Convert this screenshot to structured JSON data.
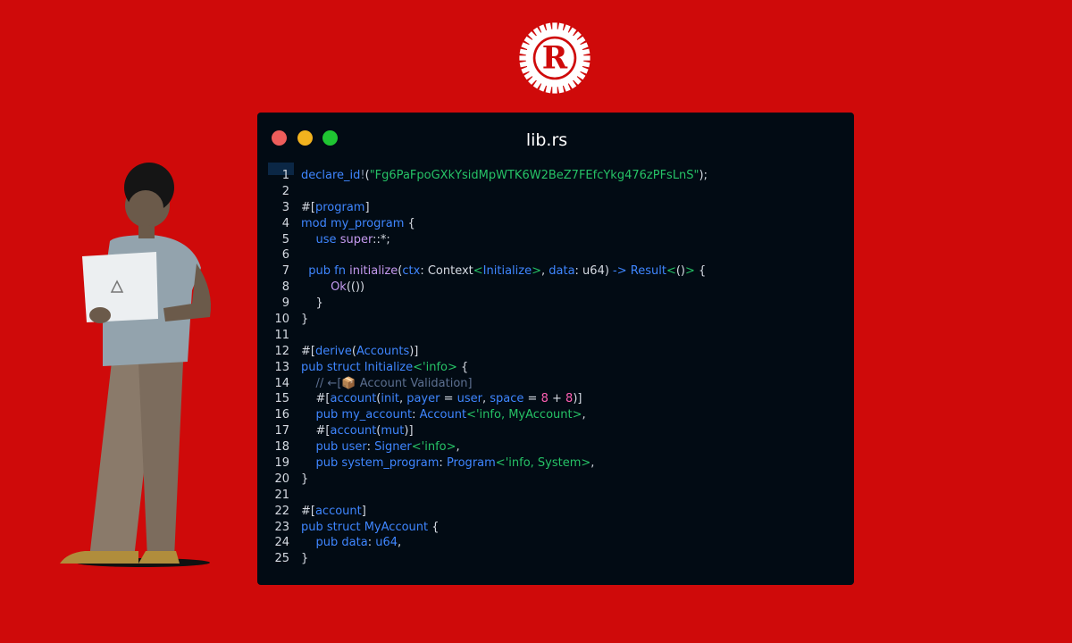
{
  "window": {
    "title": "lib.rs"
  },
  "colors": {
    "background": "#cf0a0a",
    "editor_bg": "#020b14",
    "keyword": "#3f86ff",
    "string": "#26c266",
    "number": "#ff5fb3",
    "comment": "#5c6f90"
  },
  "icons": [
    "rust-logo",
    "window-close-dot",
    "window-minimize-dot",
    "window-maximize-dot",
    "package-emoji-icon"
  ],
  "code": {
    "language": "rust",
    "lines": [
      {
        "n": "1",
        "tokens": [
          [
            "b",
            "declare_id"
          ],
          [
            "d",
            "!"
          ],
          [
            "w",
            "("
          ],
          [
            "g",
            "\"Fg6PaFpoGXkYsidMpWTK6W2BeZ7FEfcYkg476zPFsLnS\""
          ],
          [
            "w",
            ");"
          ]
        ]
      },
      {
        "n": "2",
        "tokens": []
      },
      {
        "n": "3",
        "tokens": [
          [
            "w",
            "#["
          ],
          [
            "b",
            "program"
          ],
          [
            "w",
            "]"
          ]
        ]
      },
      {
        "n": "4",
        "tokens": [
          [
            "b",
            "mod "
          ],
          [
            "b",
            "my_program"
          ],
          [
            "w",
            " {"
          ]
        ]
      },
      {
        "n": "5",
        "tokens": [
          [
            "w",
            "    "
          ],
          [
            "b",
            "use "
          ],
          [
            "v",
            "super"
          ],
          [
            "w",
            "::*;"
          ]
        ]
      },
      {
        "n": "6",
        "tokens": []
      },
      {
        "n": "7",
        "tokens": [
          [
            "w",
            "  "
          ],
          [
            "b",
            "pub fn "
          ],
          [
            "v",
            "initialize"
          ],
          [
            "w",
            "("
          ],
          [
            "b",
            "ctx"
          ],
          [
            "w",
            ": Context"
          ],
          [
            "g",
            "<"
          ],
          [
            "b",
            "Initialize"
          ],
          [
            "g",
            ">"
          ],
          [
            "w",
            ", "
          ],
          [
            "b",
            "data"
          ],
          [
            "w",
            ": u64) "
          ],
          [
            "b",
            "-> Result"
          ],
          [
            "g",
            "<"
          ],
          [
            "w",
            "()"
          ],
          [
            "g",
            ">"
          ],
          [
            "w",
            " {"
          ]
        ]
      },
      {
        "n": "8",
        "tokens": [
          [
            "w",
            "        "
          ],
          [
            "v",
            "Ok"
          ],
          [
            "w",
            "(())"
          ]
        ]
      },
      {
        "n": "9",
        "tokens": [
          [
            "w",
            "    }"
          ]
        ]
      },
      {
        "n": "10",
        "tokens": [
          [
            "w",
            "}"
          ]
        ]
      },
      {
        "n": "11",
        "tokens": []
      },
      {
        "n": "12",
        "tokens": [
          [
            "w",
            "#["
          ],
          [
            "b",
            "derive"
          ],
          [
            "w",
            "("
          ],
          [
            "b",
            "Accounts"
          ],
          [
            "w",
            ")]"
          ]
        ]
      },
      {
        "n": "13",
        "tokens": [
          [
            "b",
            "pub struct "
          ],
          [
            "b",
            "Initialize"
          ],
          [
            "g",
            "<'info>"
          ],
          [
            "w",
            " {"
          ]
        ]
      },
      {
        "n": "14",
        "tokens": [
          [
            "w",
            "    "
          ],
          [
            "c",
            "// ←[📦 Account Validation]"
          ]
        ]
      },
      {
        "n": "15",
        "tokens": [
          [
            "w",
            "    #["
          ],
          [
            "b",
            "account"
          ],
          [
            "w",
            "("
          ],
          [
            "b",
            "init"
          ],
          [
            "w",
            ", "
          ],
          [
            "b",
            "payer"
          ],
          [
            "w",
            " = "
          ],
          [
            "b",
            "user"
          ],
          [
            "w",
            ", "
          ],
          [
            "b",
            "space"
          ],
          [
            "w",
            " = "
          ],
          [
            "p",
            "8"
          ],
          [
            "w",
            " + "
          ],
          [
            "p",
            "8"
          ],
          [
            "w",
            ")]"
          ]
        ]
      },
      {
        "n": "16",
        "tokens": [
          [
            "w",
            "    "
          ],
          [
            "b",
            "pub "
          ],
          [
            "b",
            "my_account"
          ],
          [
            "w",
            ": "
          ],
          [
            "b",
            "Account"
          ],
          [
            "g",
            "<'info, MyAccount>"
          ],
          [
            "w",
            ","
          ]
        ]
      },
      {
        "n": "17",
        "tokens": [
          [
            "w",
            "    #["
          ],
          [
            "b",
            "account"
          ],
          [
            "w",
            "("
          ],
          [
            "b",
            "mut"
          ],
          [
            "w",
            ")]"
          ]
        ]
      },
      {
        "n": "18",
        "tokens": [
          [
            "w",
            "    "
          ],
          [
            "b",
            "pub "
          ],
          [
            "b",
            "user"
          ],
          [
            "w",
            ": "
          ],
          [
            "b",
            "Signer"
          ],
          [
            "g",
            "<'info>"
          ],
          [
            "w",
            ","
          ]
        ]
      },
      {
        "n": "19",
        "tokens": [
          [
            "w",
            "    "
          ],
          [
            "b",
            "pub "
          ],
          [
            "b",
            "system_program"
          ],
          [
            "w",
            ": "
          ],
          [
            "b",
            "Program"
          ],
          [
            "g",
            "<'info, System>"
          ],
          [
            "w",
            ","
          ]
        ]
      },
      {
        "n": "20",
        "tokens": [
          [
            "w",
            "}"
          ]
        ]
      },
      {
        "n": "21",
        "tokens": []
      },
      {
        "n": "22",
        "tokens": [
          [
            "w",
            "#["
          ],
          [
            "b",
            "account"
          ],
          [
            "w",
            "]"
          ]
        ]
      },
      {
        "n": "23",
        "tokens": [
          [
            "b",
            "pub struct "
          ],
          [
            "b",
            "MyAccount"
          ],
          [
            "w",
            " {"
          ]
        ]
      },
      {
        "n": "24",
        "tokens": [
          [
            "w",
            "    "
          ],
          [
            "b",
            "pub "
          ],
          [
            "b",
            "data"
          ],
          [
            "w",
            ": "
          ],
          [
            "b",
            "u64"
          ],
          [
            "w",
            ","
          ]
        ]
      },
      {
        "n": "25",
        "tokens": [
          [
            "w",
            "}"
          ]
        ]
      }
    ]
  }
}
